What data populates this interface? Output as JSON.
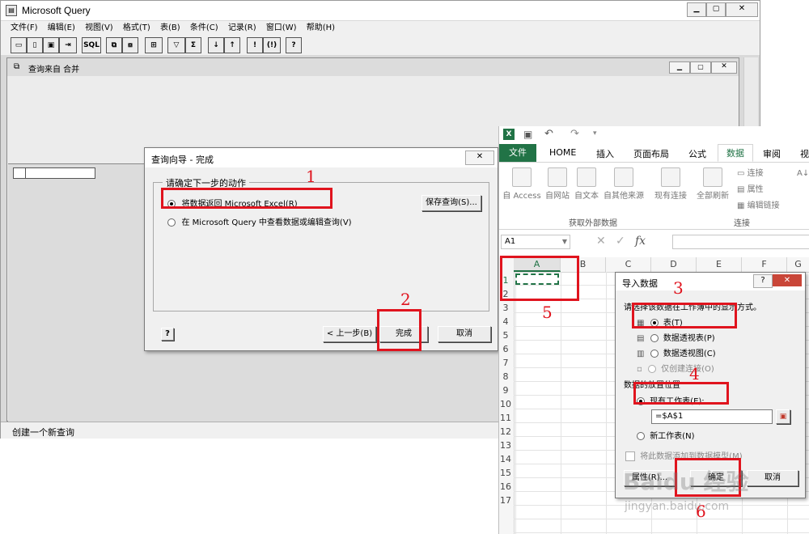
{
  "mq": {
    "title": "Microsoft Query",
    "menu": [
      "文件(F)",
      "编辑(E)",
      "视图(V)",
      "格式(T)",
      "表(B)",
      "条件(C)",
      "记录(R)",
      "窗口(W)",
      "帮助(H)"
    ],
    "toolbar": [
      "SQL",
      "Σ",
      "!",
      "?"
    ],
    "inner_title": "查询来自 合并",
    "status": "创建一个新查询"
  },
  "wizard": {
    "title": "查询向导 - 完成",
    "group_label": "请确定下一步的动作",
    "opt_return": "将数据返回 Microsoft Excel(R)",
    "opt_view": "在 Microsoft Query 中查看数据或编辑查询(V)",
    "save_btn": "保存查询(S)...",
    "back_btn": "< 上一步(B)",
    "finish_btn": "完成",
    "cancel_btn": "取消"
  },
  "excel": {
    "tabs": [
      "文件",
      "HOME",
      "插入",
      "页面布局",
      "公式",
      "数据",
      "审阅",
      "视"
    ],
    "active_tab": "数据",
    "ribbon": [
      "自 Access",
      "自网站",
      "自文本",
      "自其他来源",
      "现有连接",
      "全部刷新"
    ],
    "ribbon_group1": "获取外部数据",
    "ribbon_group2": "连接",
    "conn_items": [
      "连接",
      "属性",
      "编辑链接"
    ],
    "name_box": "A1",
    "fx": "fx",
    "columns": [
      "A",
      "B",
      "C",
      "D",
      "E",
      "F",
      "G"
    ],
    "rows": [
      "1",
      "2",
      "3",
      "4",
      "5",
      "6",
      "7",
      "8",
      "9",
      "10",
      "11",
      "12",
      "13",
      "14",
      "15",
      "16",
      "17"
    ]
  },
  "import": {
    "title": "导入数据",
    "prompt": "请选择该数据在工作簿中的显示方式。",
    "opt_table": "表(T)",
    "opt_pivot_table": "数据透视表(P)",
    "opt_pivot_chart": "数据透视图(C)",
    "opt_conn_only": "仅创建连接(O)",
    "location_label": "数据的放置位置",
    "opt_existing": "现有工作表(E):",
    "range_value": "=$A$1",
    "opt_new": "新工作表(N)",
    "add_model": "将此数据添加到数据模型(M)",
    "props_btn": "属性(R)...",
    "ok_btn": "确定",
    "cancel_btn": "取消"
  },
  "markers": [
    "1",
    "2",
    "3",
    "4",
    "5",
    "6"
  ],
  "watermark": "Baidu 经验",
  "watermark_url": "jingyan.baidu.com",
  "colors": {
    "excel_green": "#217346",
    "annotation_red": "#e0141e",
    "selection_dark": "#0a246a"
  }
}
